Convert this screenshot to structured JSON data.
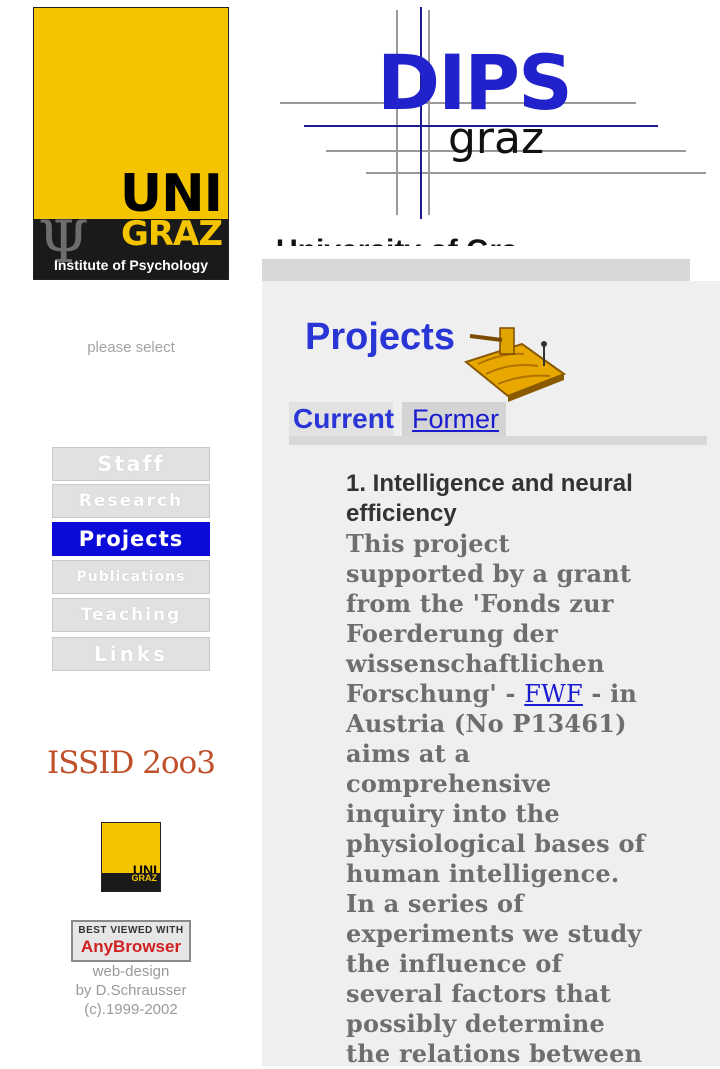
{
  "logos": {
    "uni": {
      "word": "UNI",
      "city": "GRAZ",
      "institute": "Institute of Psychology"
    },
    "dips": {
      "word": "DIPS",
      "sub": "graz"
    },
    "university_fragment": "University of Graz"
  },
  "sidebar": {
    "prompt": "please select",
    "nav": [
      {
        "label": "Staff"
      },
      {
        "label": "Research"
      },
      {
        "label": "Projects",
        "active": true
      },
      {
        "label": "Publications"
      },
      {
        "label": "Teaching"
      },
      {
        "label": "Links"
      }
    ],
    "event_logo": "ISSID 2oo3",
    "small_logo": {
      "word": "UNI",
      "city": "GRAZ"
    },
    "badge": {
      "line1": "BEST VIEWED WITH",
      "line2": "AnyBrowser"
    },
    "credits": [
      "web-design",
      "by D.Schrausser",
      "(c).1999-2002"
    ]
  },
  "main": {
    "title": "Projects",
    "tabs": [
      {
        "label": "Current",
        "active": true
      },
      {
        "label": "Former",
        "active": false
      }
    ],
    "project": {
      "heading": "1. Intelligence and neural efficiency",
      "body_before": "This project supported by a grant from the 'Fonds zur Foerderung der wissenschaftlichen Forschung' - ",
      "link_text": "FWF",
      "body_after": " - in Austria (No P13461) aims at a comprehensive inquiry into the physiological bases of human intelligence. In a series of experiments we study the influence of several factors that possibly determine the relations between"
    }
  },
  "colors": {
    "accent_blue": "#2a35d6",
    "nav_active": "#0b0bd9",
    "uni_yellow": "#f5c400",
    "issid_red": "#c0502a"
  }
}
